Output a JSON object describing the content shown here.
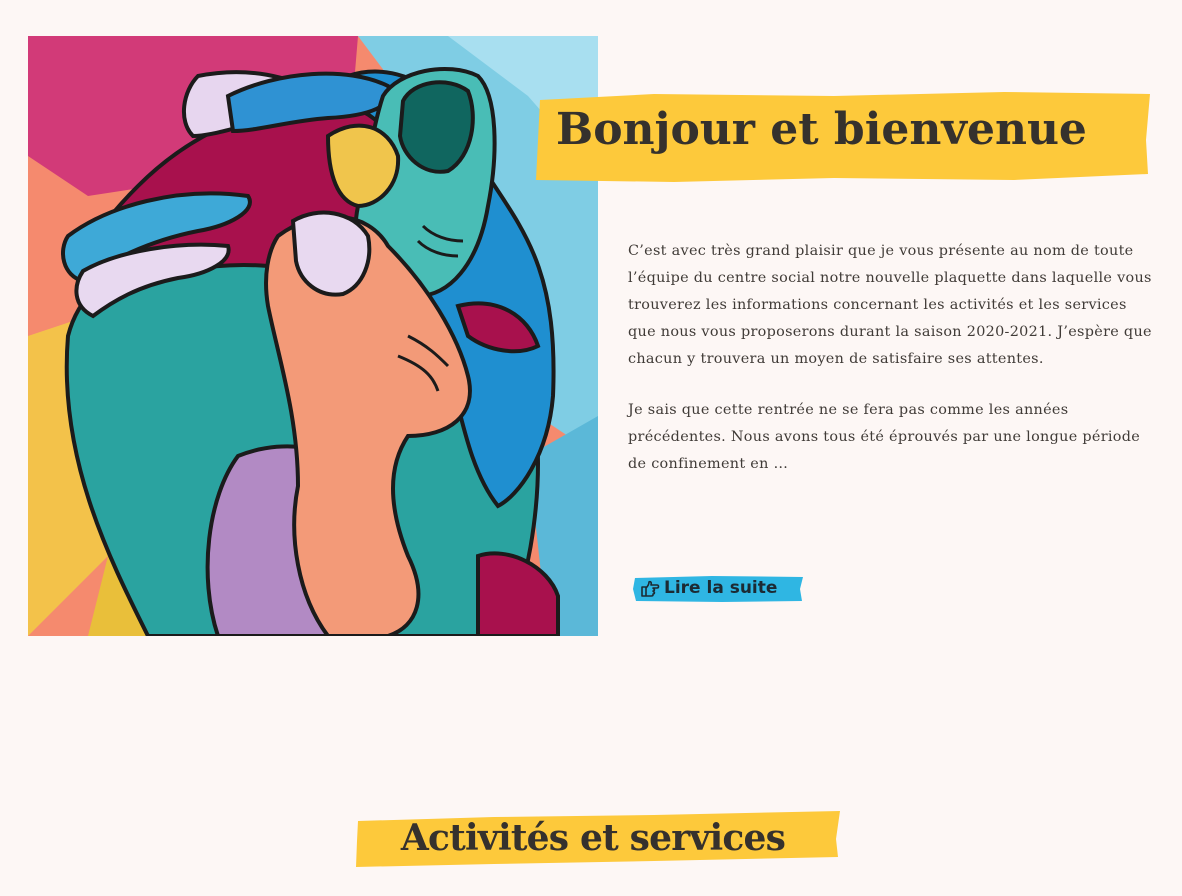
{
  "colors": {
    "background": "#fdf7f5",
    "highlight_yellow": "#fdc93b",
    "button_blue": "#2fb6e3",
    "text_dark": "#35312d"
  },
  "hero": {
    "image_icon": "abstract-hands-painting"
  },
  "welcome": {
    "title": "Bonjour et bienvenue",
    "paragraphs": [
      " C’est avec très grand plaisir que je vous présente au nom de toute l’équipe du centre social notre nouvelle plaquette dans laquelle vous trouverez les informations concernant les activités et les services que nous vous proposerons durant la saison 2020-2021. J’espère que chacun y trouvera un moyen de satisfaire ses attentes.",
      "Je sais que cette rentrée ne se fera pas comme les années précédentes. Nous avons tous été éprouvés par une longue période de confinement en …"
    ],
    "read_more_icon": "hand-pointing-right-icon",
    "read_more_label": "Lire la suite"
  },
  "section": {
    "title": "Activités et services"
  }
}
